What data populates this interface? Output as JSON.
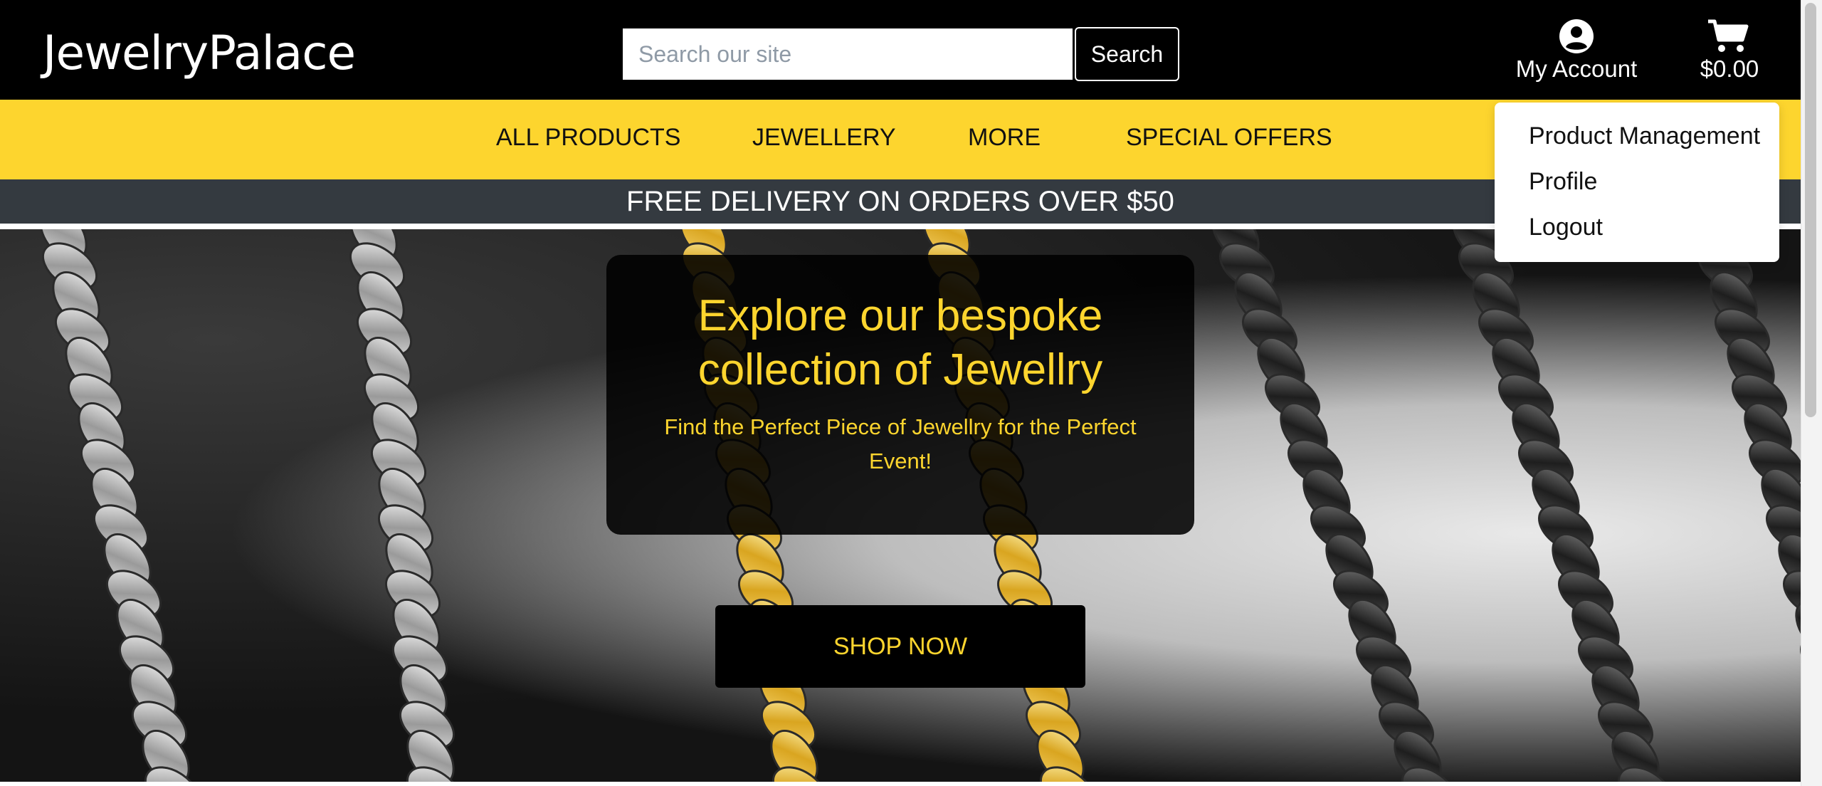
{
  "header": {
    "brand": "JewelryPalace",
    "search": {
      "placeholder": "Search our site",
      "value": "",
      "button_label": "Search"
    },
    "account": {
      "label": "My Account",
      "icon": "user-circle-icon"
    },
    "cart": {
      "total": "$0.00",
      "icon": "shopping-cart-icon"
    }
  },
  "nav": {
    "items": [
      {
        "label": "ALL PRODUCTS"
      },
      {
        "label": "JEWELLERY"
      },
      {
        "label": "MORE"
      },
      {
        "label": "SPECIAL OFFERS"
      }
    ]
  },
  "banner": {
    "text": "FREE DELIVERY ON ORDERS OVER $50"
  },
  "hero": {
    "title_line1": "Explore our bespoke",
    "title_line2": "collection of Jewellry",
    "subtitle_line1": "Find the Perfect Piece of Jewellry for the Perfect",
    "subtitle_line2": "Event!",
    "cta_label": "SHOP NOW"
  },
  "account_menu": {
    "items": [
      {
        "label": "Product Management"
      },
      {
        "label": "Profile"
      },
      {
        "label": "Logout"
      }
    ]
  },
  "colors": {
    "header_bg": "#000000",
    "nav_bg": "#fdd52e",
    "banner_bg": "#343a40",
    "accent": "#fdd52e"
  }
}
